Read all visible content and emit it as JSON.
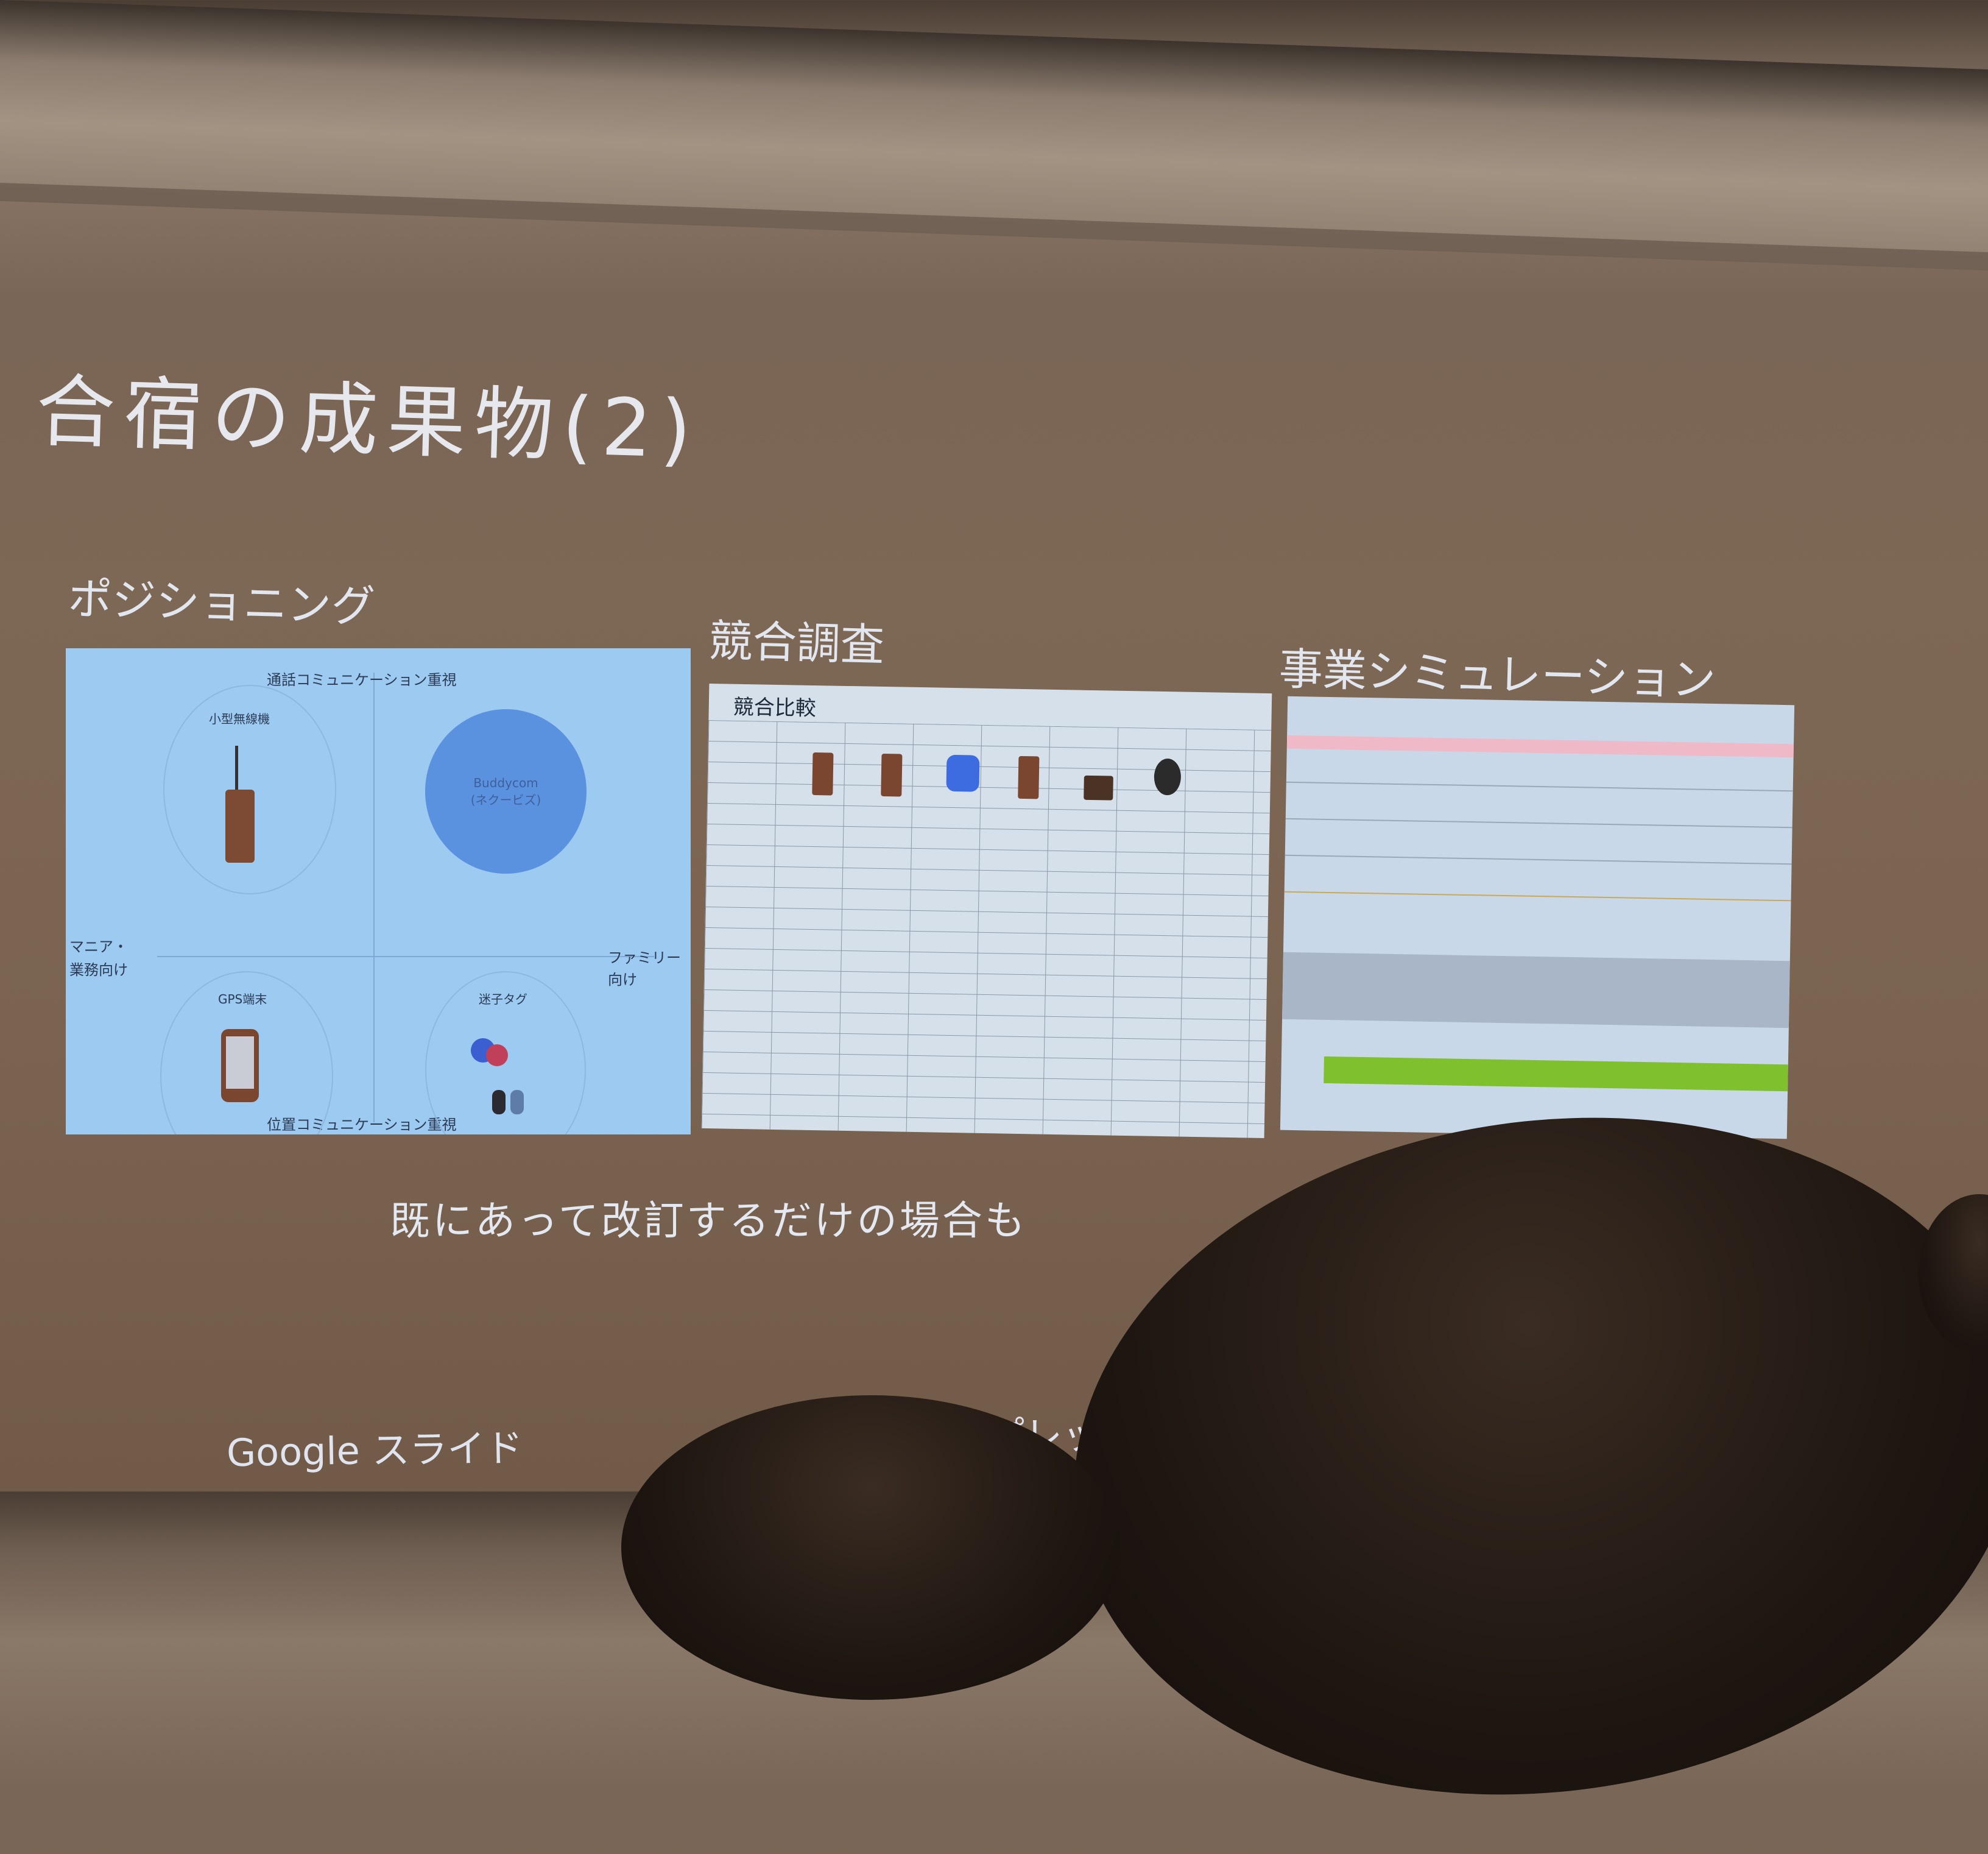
{
  "slide": {
    "title": "合宿の成果物(2)",
    "sections": [
      {
        "heading": "ポジショニング"
      },
      {
        "heading": "競合調査"
      },
      {
        "heading": "事業シミュレーション"
      }
    ],
    "positioning_map": {
      "top_axis": "通話コミュニケーション重視",
      "bottom_axis": "位置コミュニケーション重視",
      "left_axis": [
        "マニア・",
        "業務向け"
      ],
      "right_axis": [
        "ファミリー",
        "向け"
      ],
      "quadrants": {
        "top_left": "小型無線機",
        "top_right": [
          "Buddycom",
          "(ネクービズ)"
        ],
        "bottom_left": "GPS端末",
        "bottom_right": "迷子タグ"
      },
      "colors": {
        "background": "#9ccaf0",
        "highlight_circle": "#5b92e0",
        "device": "#7d4a34"
      }
    },
    "competitor_table": {
      "title": "競合比較"
    },
    "caption": "既にあって改訂するだけの場合も",
    "footer": {
      "left": "Google スライド",
      "right_partial": "プレッ"
    }
  }
}
